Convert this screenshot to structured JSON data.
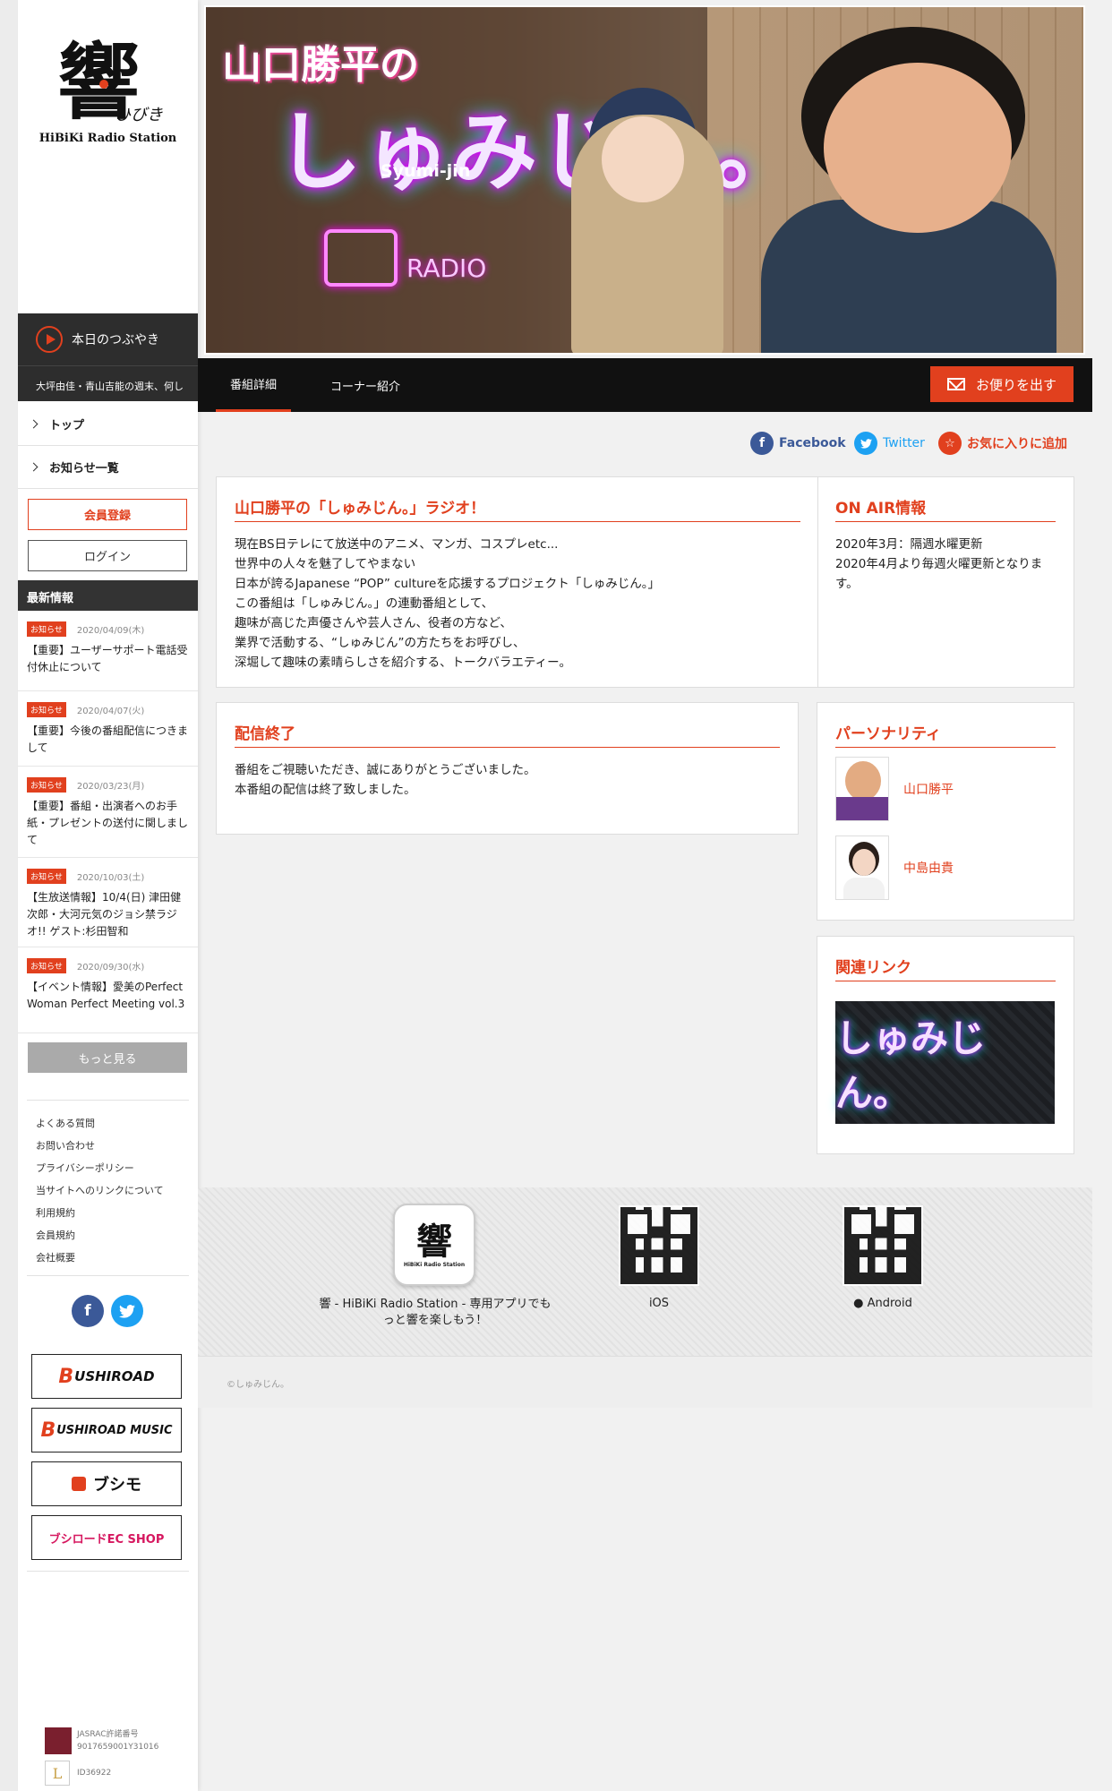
{
  "brand": {
    "logo_text": "HiBiKi Radio Station",
    "logo_kanji": "響",
    "logo_kana": "ひびき"
  },
  "sidebar": {
    "tsubuyaki_label": "本日のつぶやき",
    "ticker": "大坪由佳・青山吉能の週末、何し",
    "nav": [
      {
        "label": "トップ"
      },
      {
        "label": "お知らせ一覧"
      }
    ],
    "register_label": "会員登録",
    "login_label": "ログイン",
    "news_heading": "最新情報",
    "news": [
      {
        "badge": "お知らせ",
        "date": "2020/04/09(木)",
        "title": "【重要】ユーザーサポート電話受付休止について"
      },
      {
        "badge": "お知らせ",
        "date": "2020/04/07(火)",
        "title": "【重要】今後の番組配信につきまして"
      },
      {
        "badge": "お知らせ",
        "date": "2020/03/23(月)",
        "title": "【重要】番組・出演者へのお手紙・プレゼントの送付に関しまして"
      },
      {
        "badge": "お知らせ",
        "date": "2020/10/03(土)",
        "title": "【生放送情報】10/4(日) 津田健次郎・大河元気のジョシ禁ラジオ!! ゲスト:杉田智和"
      },
      {
        "badge": "お知らせ",
        "date": "2020/09/30(水)",
        "title": "【イベント情報】愛美のPerfect Woman Perfect Meeting vol.3"
      }
    ],
    "more_label": "もっと見る",
    "footer_links": [
      "よくある質問",
      "お問い合わせ",
      "プライバシーポリシー",
      "当サイトへのリンクについて",
      "利用規約",
      "会員規約",
      "会社概要"
    ],
    "partners": [
      {
        "name": "BUSHIROAD",
        "initial": "B",
        "rest": "USHIROAD"
      },
      {
        "name": "BUSHIROAD MUSIC",
        "initial": "B",
        "rest": "USHIROAD MUSIC"
      },
      {
        "name": "ブシモ",
        "initial": "",
        "rest": "ブシモ"
      },
      {
        "name": "ブシロードEC SHOP",
        "initial": "",
        "rest": "ブシロードEC SHOP"
      }
    ],
    "jasrac_line1": "JASRAC許諾番号",
    "jasrac_line2": "9017659001Y31016",
    "id_text": "ID36922"
  },
  "hero": {
    "title_small": "山口勝平の",
    "title_big": "しゅみじん。",
    "title_romaji": "Syumi-jin",
    "radio_label": "RADIO"
  },
  "tabs": [
    {
      "label": "番組詳細",
      "active": true
    },
    {
      "label": "コーナー紹介",
      "active": false
    }
  ],
  "letter_button": "お便りを出す",
  "share": {
    "facebook": "Facebook",
    "twitter": "Twitter",
    "favorite": "お気に入りに追加"
  },
  "program": {
    "title": "山口勝平の「しゅみじん。」ラジオ！",
    "lines": [
      "現在BS日テレにて放送中のアニメ、マンガ、コスプレetc...",
      "世界中の人々を魅了してやまない",
      "日本が誇るJapanese “POP” cultureを応援するプロジェクト「しゅみじん。」",
      "この番組は「しゅみじん。」の連動番組として、",
      "趣味が高じた声優さんや芸人さん、役者の方など、",
      "業界で活動する、“しゅみじん”の方たちをお呼びし、",
      "深堀して趣味の素晴らしさを紹介する、トークバラエティー。"
    ]
  },
  "onair": {
    "title": "ON AIR情報",
    "lines": [
      "2020年3月：隔週水曜更新",
      "2020年4月より毎週火曜更新となります。"
    ]
  },
  "ended": {
    "title": "配信終了",
    "lines": [
      "番組をご視聴いただき、誠にありがとうございました。",
      "本番組の配信は終了致しました。"
    ]
  },
  "personality": {
    "title": "パーソナリティ",
    "people": [
      {
        "name": "山口勝平"
      },
      {
        "name": "中島由貴"
      }
    ]
  },
  "related": {
    "title": "関連リンク",
    "banner_text": "しゅみじん。"
  },
  "app": {
    "caption": "響 - HiBiKi Radio Station - 専用アプリでもっと響を楽しもう！",
    "icon_text": "HiBiKi Radio Station",
    "ios": "iOS",
    "android": "Android"
  },
  "copyright": "©しゅみじん。",
  "colors": {
    "accent": "#e1401e",
    "facebook": "#3b5998",
    "twitter": "#1da1f2"
  }
}
